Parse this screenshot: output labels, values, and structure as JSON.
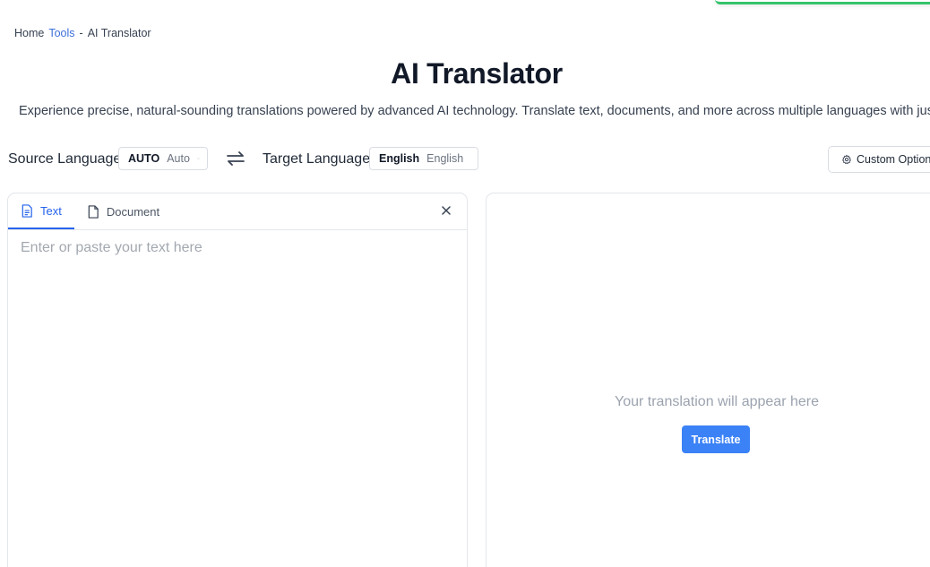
{
  "breadcrumb": {
    "home": "Home",
    "tools": "Tools",
    "separator": "-",
    "current": "AI Translator"
  },
  "page": {
    "title": "AI Translator",
    "subtitle": "Experience precise, natural-sounding translations powered by advanced AI technology. Translate text, documents, and more across multiple languages with just a few clicks."
  },
  "languages": {
    "source_label": "Source Language",
    "source_code": "AUTO",
    "source_name": "Auto",
    "target_label": "Target Language",
    "target_code": "English",
    "target_name": "English",
    "swap_icon": "swap-arrows-icon"
  },
  "options": {
    "custom_label": "Custom Options",
    "icon": "gear-icon"
  },
  "input_panel": {
    "tabs": [
      {
        "label": "Text",
        "icon": "text-file-icon",
        "active": true
      },
      {
        "label": "Document",
        "icon": "document-icon",
        "active": false
      }
    ],
    "placeholder": "Enter or paste your text here"
  },
  "output_panel": {
    "placeholder": "Your translation will appear here",
    "translate_label": "Translate"
  },
  "colors": {
    "accent": "#2563eb",
    "button": "#3b82f6",
    "toast": "#34c36b"
  }
}
